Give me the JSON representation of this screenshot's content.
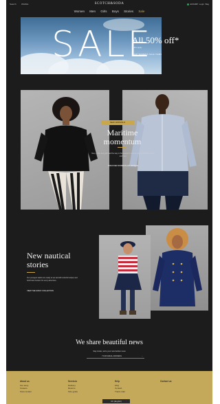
{
  "header": {
    "left_links": [
      "Search",
      "Wishlist"
    ],
    "brand": "SCOTCH&SODA",
    "right_links": [
      "EN/GBP",
      "Login",
      "Bag"
    ],
    "nav": [
      "Women",
      "Men",
      "Girls",
      "Boys",
      "Stories",
      "Sale"
    ]
  },
  "hero": {
    "big_word": "SALE",
    "title": "All 50% off*",
    "subtitle": "*T&Cs apply",
    "link": "SHOP WOMEN'S SALE ITEMS"
  },
  "feature": {
    "tag": "NEW ARRIVALS",
    "title": "Maritime momentum",
    "text": "Navy, white and gold lead the way in this season's nautical-inspired edit for women and men.",
    "link": "DISCOVER WOMEN'S COLLECTION"
  },
  "stories": {
    "title": "New nautical stories",
    "text": "Our youngest sailors are ready to set sail with colourful stripes and bold brass buttons for every adventure.",
    "link": "VIEW THE GIRLS' COLLECTION"
  },
  "newsletter": {
    "title": "We share beautiful news",
    "text": "Stay inside, we're your new fashion news",
    "input_placeholder": "YOUR EMAIL ADDRESS",
    "arrow": "→"
  },
  "footer": {
    "columns": [
      {
        "heading": "About us",
        "items": [
          "Our story",
          "Careers",
          "Store locator"
        ]
      },
      {
        "heading": "Services",
        "items": [
          "Delivery",
          "Returns",
          "Size guide"
        ]
      },
      {
        "heading": "Help",
        "items": [
          "FAQ",
          "Contact",
          "Track order"
        ]
      },
      {
        "heading": "Contact us",
        "items": []
      }
    ],
    "language": "UK (English)"
  },
  "colors": {
    "background": "#1c1c1c",
    "accent": "#c9a74a",
    "footer": "#c4a95a"
  }
}
